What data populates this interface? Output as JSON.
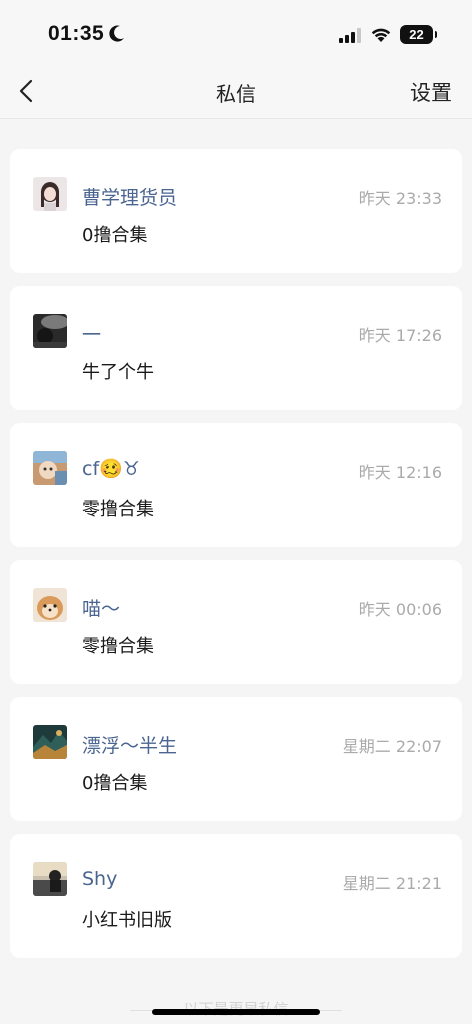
{
  "status_bar": {
    "time": "01:35",
    "battery": "22"
  },
  "nav": {
    "title": "私信",
    "settings_label": "设置"
  },
  "messages": [
    {
      "name": "曹学理货员",
      "time": "昨天 23:33",
      "preview": "0撸合集",
      "avatar_icon": "anime-girl-avatar"
    },
    {
      "name": "一",
      "time": "昨天 17:26",
      "preview": "牛了个牛",
      "avatar_icon": "dark-photo-avatar"
    },
    {
      "name": "cf🥴♉",
      "time": "昨天 12:16",
      "preview": "零撸合集",
      "avatar_icon": "cartoon-avatar"
    },
    {
      "name": "喵～",
      "time": "昨天 00:06",
      "preview": "零撸合集",
      "avatar_icon": "dog-avatar"
    },
    {
      "name": "漂浮～半生",
      "time": "星期二 22:07",
      "preview": "0撸合集",
      "avatar_icon": "landscape-avatar"
    },
    {
      "name": "Shy",
      "time": "星期二 21:21",
      "preview": "小红书旧版",
      "avatar_icon": "sunset-avatar"
    }
  ],
  "footer_text": "以下是更早私信",
  "colors": {
    "name": "#4a6590",
    "time": "#aaaaaa",
    "background": "#f5f5f5",
    "card": "#ffffff"
  }
}
